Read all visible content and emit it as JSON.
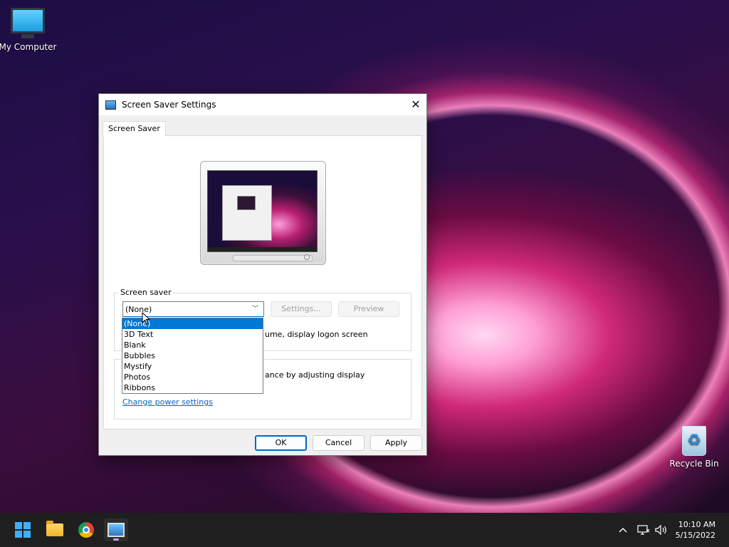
{
  "desktop": {
    "icons": [
      {
        "label": "My Computer"
      },
      {
        "label": "Recycle Bin"
      }
    ]
  },
  "dialog": {
    "title": "Screen Saver Settings",
    "close_glyph": "✕",
    "tab_label": "Screen Saver",
    "screen_saver_group_label": "Screen saver",
    "selected_value": "(None)",
    "settings_label": "Settings...",
    "preview_label": "Preview",
    "resume_text_partial": "ume, display logon screen",
    "power_text_partial": "ance by adjusting display",
    "power_link": "Change power settings",
    "ok_label": "OK",
    "cancel_label": "Cancel",
    "apply_label": "Apply"
  },
  "dropdown": {
    "options": [
      "(None)",
      "3D Text",
      "Blank",
      "Bubbles",
      "Mystify",
      "Photos",
      "Ribbons"
    ],
    "selected_index": 0
  },
  "taskbar": {
    "time": "10:10 AM",
    "date": "5/15/2022",
    "tray_icons": [
      "chevron-up-icon",
      "network-icon",
      "volume-icon"
    ],
    "apps": [
      "start-icon",
      "file-explorer-icon",
      "chrome-icon",
      "screen-saver-icon"
    ]
  },
  "colors": {
    "accent": "#0078d7",
    "link": "#0066cc",
    "taskbar": "#1f1f1f"
  }
}
